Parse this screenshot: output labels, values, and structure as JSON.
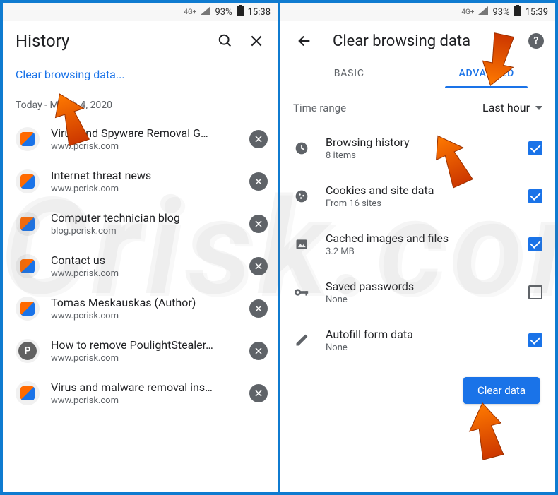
{
  "left": {
    "statusbar": {
      "net": "4G+",
      "battery": "93%",
      "time": "15:38"
    },
    "title": "History",
    "clear_link": "Clear browsing data...",
    "date_header": "Today - March 4, 2020",
    "items": [
      {
        "title": "Virus and Spyware Removal G…",
        "url": "www.pcrisk.com",
        "fav": "pcrisk"
      },
      {
        "title": "Internet threat news",
        "url": "www.pcrisk.com",
        "fav": "pcrisk"
      },
      {
        "title": "Computer technician blog",
        "url": "blog.pcrisk.com",
        "fav": "pcrisk"
      },
      {
        "title": "Contact us",
        "url": "www.pcrisk.com",
        "fav": "pcrisk"
      },
      {
        "title": "Tomas Meskauskas (Author)",
        "url": "www.pcrisk.com",
        "fav": "pcrisk"
      },
      {
        "title": "How to remove PoulightStealer…",
        "url": "www.pcrisk.com",
        "fav": "p"
      },
      {
        "title": "Virus and malware removal ins…",
        "url": "www.pcrisk.com",
        "fav": "pcrisk"
      }
    ]
  },
  "right": {
    "statusbar": {
      "net": "4G+",
      "battery": "93%",
      "time": "15:39"
    },
    "title": "Clear browsing data",
    "tabs": {
      "basic": "BASIC",
      "advanced": "ADVANCED"
    },
    "range": {
      "label": "Time range",
      "value": "Last hour"
    },
    "options": [
      {
        "icon": "clock",
        "title": "Browsing history",
        "sub": "8 items",
        "checked": true
      },
      {
        "icon": "cookie",
        "title": "Cookies and site data",
        "sub": "From 16 sites",
        "checked": true
      },
      {
        "icon": "image",
        "title": "Cached images and files",
        "sub": "3.2 MB",
        "checked": true
      },
      {
        "icon": "key",
        "title": "Saved passwords",
        "sub": "None",
        "checked": false
      },
      {
        "icon": "pencil",
        "title": "Autofill form data",
        "sub": "None",
        "checked": true
      }
    ],
    "clear_button": "Clear data"
  },
  "watermark": "PCrisk.com"
}
